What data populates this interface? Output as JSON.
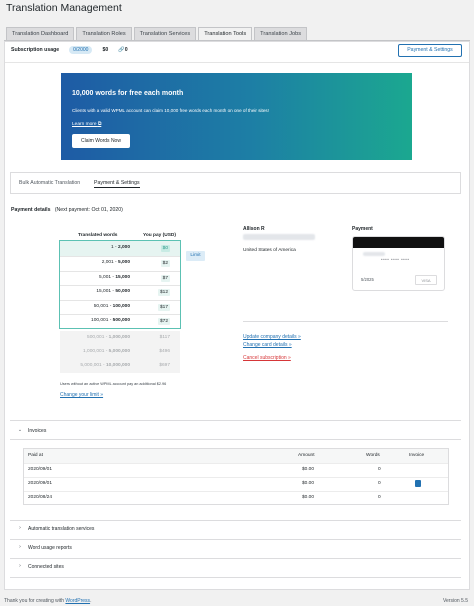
{
  "page": {
    "title": "Translation Management"
  },
  "tabs": [
    {
      "label": "Translation Dashboard",
      "active": false
    },
    {
      "label": "Translation Roles",
      "active": false
    },
    {
      "label": "Translation Services",
      "active": false
    },
    {
      "label": "Translation Tools",
      "active": true
    },
    {
      "label": "Translation Jobs",
      "active": false
    }
  ],
  "usage": {
    "label": "Subscription usage",
    "badge": "0/2000",
    "amount": "$0",
    "links_count": "0",
    "payment_button": "Payment & Settings"
  },
  "promo": {
    "title": "10,000 words for free each month",
    "description": "Clients with a valid WPML account can claim 10,000 free words each month on one of their sites!",
    "learn_more": "Learn more",
    "button": "Claim Words Now",
    "gradient": [
      "#1e5ba5",
      "#1d7fa5",
      "#1ba890"
    ]
  },
  "subtabs": [
    {
      "label": "Bulk Automatic Translation",
      "active": false
    },
    {
      "label": "Payment & Settings",
      "active": true
    }
  ],
  "payment": {
    "label": "Payment details",
    "next_payment": "(Next payment: Oct 01, 2020)",
    "col_words": "Translated words",
    "col_pay": "You pay (USD)",
    "tiers": [
      {
        "from": "1",
        "to": "2,000",
        "price": "$0",
        "selected": true
      },
      {
        "from": "2,001",
        "to": "5,000",
        "price": "$2",
        "selected": false
      },
      {
        "from": "5,001",
        "to": "15,000",
        "price": "$7",
        "selected": false
      },
      {
        "from": "15,001",
        "to": "50,000",
        "price": "$12",
        "selected": false
      },
      {
        "from": "50,001",
        "to": "100,000",
        "price": "$17",
        "selected": false
      },
      {
        "from": "100,001",
        "to": "500,000",
        "price": "$72",
        "selected": false
      }
    ],
    "tiers_disabled": [
      {
        "from": "500,001",
        "to": "1,000,000",
        "price": "$117"
      },
      {
        "from": "1,000,001",
        "to": "5,000,000",
        "price": "$496"
      },
      {
        "from": "5,000,001",
        "to": "10,000,000",
        "price": "$697"
      }
    ],
    "limit_button": "Limit",
    "note": "Users without an active WPML account pay an additional $2.96",
    "change_limit": "Change your limit »"
  },
  "company": {
    "name": "Allison R",
    "country": "United States of America",
    "update_link": "Update company details »",
    "change_card": "Change card details »",
    "cancel": "Cancel subscription »"
  },
  "card": {
    "heading": "Payment",
    "dots": "••••   ••••   ••••",
    "expiry": "5/2025",
    "brand": "VISA"
  },
  "invoices": {
    "title": "Invoices",
    "columns": [
      "Paid at",
      "Amount",
      "Words",
      "Invoice"
    ],
    "rows": [
      {
        "date": "2020/09/01",
        "amount": "$0.00",
        "words": "0",
        "has_invoice": false
      },
      {
        "date": "2020/09/01",
        "amount": "$0.00",
        "words": "0",
        "has_invoice": true
      },
      {
        "date": "2020/08/24",
        "amount": "$0.00",
        "words": "0",
        "has_invoice": false
      }
    ]
  },
  "sections": [
    "Automatic translation services",
    "Word usage reports",
    "Connected sites"
  ],
  "footer": {
    "thanks": "Thank you for creating with ",
    "wordpress": "WordPress",
    "thanks_end": ".",
    "version": "Version 5.5"
  }
}
